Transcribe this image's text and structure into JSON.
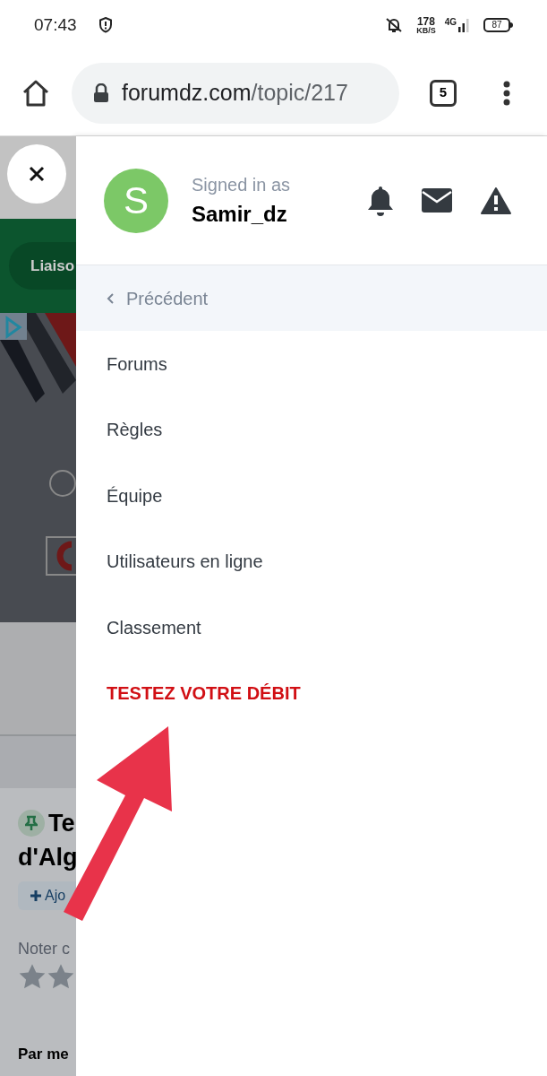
{
  "status_bar": {
    "time": "07:43",
    "speed": "178",
    "speed_unit": "KB/S",
    "network": "4G",
    "battery": "87"
  },
  "browser": {
    "url_host": "forumdz.com",
    "url_path": "/topic/217",
    "tab_count": "5"
  },
  "page": {
    "breadcrumb": "Liaiso",
    "title_lines": [
      "Te",
      "d'Alg"
    ],
    "follow_button": "Ajo",
    "rating_label": "Noter c",
    "author_line": "Par me"
  },
  "drawer": {
    "signed_in_label": "Signed in as",
    "username": "Samir_dz",
    "avatar_letter": "S",
    "back_label": "Précédent",
    "items": [
      {
        "label": "Forums",
        "kind": "link"
      },
      {
        "label": "Règles",
        "kind": "link"
      },
      {
        "label": "Équipe",
        "kind": "link"
      },
      {
        "label": "Utilisateurs en ligne",
        "kind": "link"
      },
      {
        "label": "Classement",
        "kind": "link"
      },
      {
        "label": "TESTEZ VOTRE DÉBIT",
        "kind": "highlight"
      }
    ]
  }
}
